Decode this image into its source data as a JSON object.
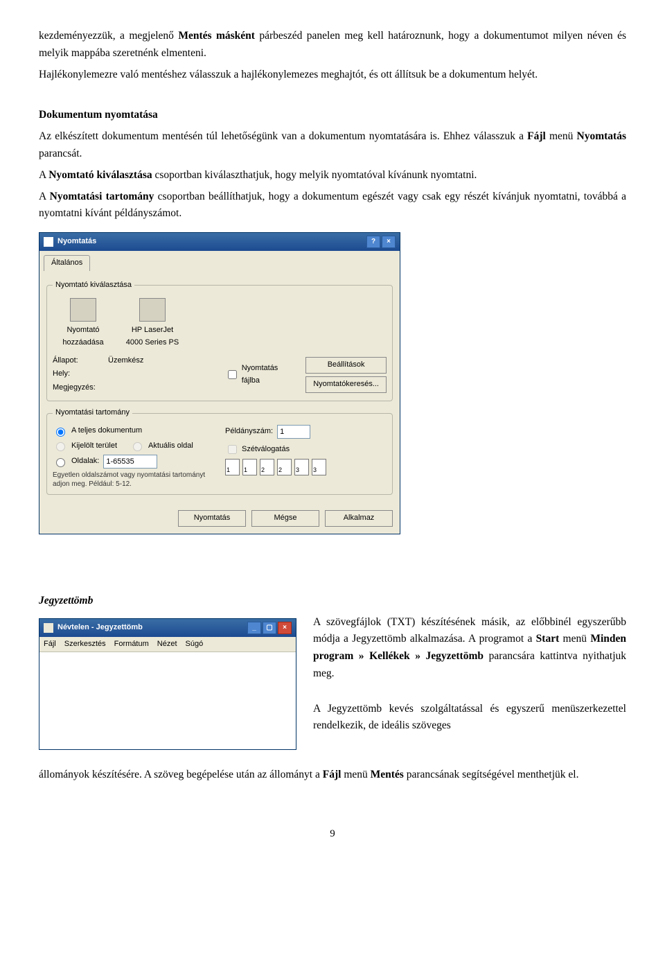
{
  "para1": {
    "t1": "kezdeményezzük, a megjelenő ",
    "b1": "Mentés másként",
    "t2": " párbeszéd panelen meg kell határoznunk, hogy a dokumentumot milyen néven és melyik mappába szeretnénk elmenteni."
  },
  "para2": "Hajlékonylemezre való mentéshez válasszuk a hajlékonylemezes meghajtót, és ott állítsuk be a dokumentum helyét.",
  "section_print_title": "Dokumentum nyomtatása",
  "print_p1a": "Az elkészített dokumentum mentésén túl lehetőségünk van a dokumentum nyomtatására is. Ehhez válasszuk a ",
  "print_p1b": "Fájl",
  "print_p1c": " menü ",
  "print_p1d": "Nyomtatás",
  "print_p1e": " parancsát.",
  "print_p2a": "A ",
  "print_p2b": "Nyomtató kiválasztása",
  "print_p2c": " csoportban kiválaszthatjuk, hogy melyik nyomtatóval kívánunk nyomtatni.",
  "print_p3a": "A ",
  "print_p3b": "Nyomtatási tartomány",
  "print_p3c": " csoportban beállíthatjuk, hogy a dokumentum egészét vagy csak egy részét kívánjuk nyomtatni, továbbá a nyomtatni kívánt példányszámot.",
  "dialog": {
    "title": "Nyomtatás",
    "tab": "Általános",
    "group_select": "Nyomtató kiválasztása",
    "icon_add": "Nyomtató hozzáadása",
    "icon_hp": "HP LaserJet 4000 Series PS",
    "lbl_status": "Állapot:",
    "val_status": "Üzemkész",
    "lbl_location": "Hely:",
    "lbl_comment": "Megjegyzés:",
    "chk_tofile": "Nyomtatás fájlba",
    "btn_settings": "Beállítások",
    "btn_find": "Nyomtatókeresés...",
    "group_range": "Nyomtatási tartomány",
    "r_all": "A teljes dokumentum",
    "r_sel": "Kijelölt terület",
    "r_cur": "Aktuális oldal",
    "r_pages": "Oldalak:",
    "pages_val": "1-65535",
    "range_note": "Egyetlen oldalszámot vagy nyomtatási tartományt adjon meg. Például: 5-12.",
    "lbl_copies": "Példányszám:",
    "copies_val": "1",
    "chk_collate": "Szétválogatás",
    "collate_1": "1",
    "collate_2": "2",
    "collate_3": "3",
    "btn_print": "Nyomtatás",
    "btn_cancel": "Mégse",
    "btn_apply": "Alkalmaz"
  },
  "section_notepad_title": "Jegyzettömb",
  "notepad": {
    "title": "Névtelen - Jegyzettömb",
    "m_file": "Fájl",
    "m_edit": "Szerkesztés",
    "m_format": "Formátum",
    "m_view": "Nézet",
    "m_help": "Súgó"
  },
  "np_p1a": "A szövegfájlok (TXT) készítésének másik, az előbbinél egyszerűbb módja a Jegyzettömb alkalmazása. A programot a ",
  "np_p1b": "Start",
  "np_p1c": " menü ",
  "np_p1d": "Minden program » Kellékek » Jegyzettömb",
  "np_p1e": " parancsára kattintva nyithatjuk meg.",
  "np_p2a": "A Jegyzettömb kevés szolgáltatással és egyszerű menüszerkezettel rendelkezik, de ideális szöveges",
  "np_p3a": "állományok készítésére. A szöveg begépelése után az állományt a ",
  "np_p3b": "Fájl",
  "np_p3c": " menü ",
  "np_p3d": "Mentés",
  "np_p3e": " parancsának segítségével menthetjük el.",
  "page_number": "9"
}
